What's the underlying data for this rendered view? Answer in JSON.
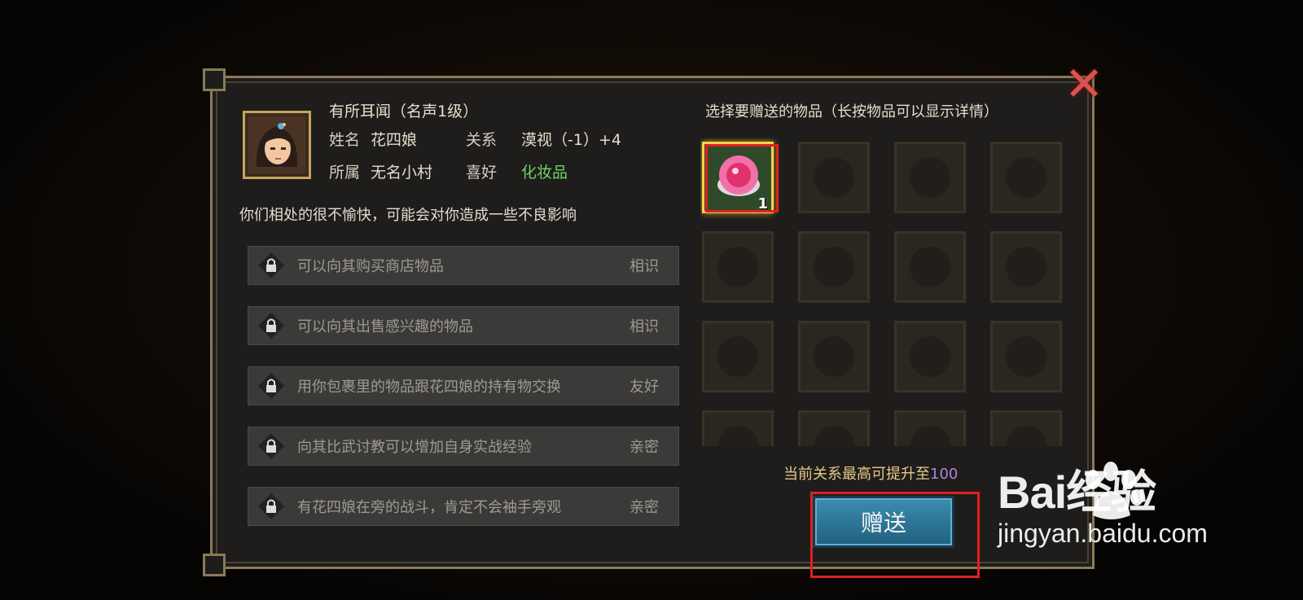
{
  "header": {
    "reputation": "有所耳闻（名声1级）",
    "name_label": "姓名",
    "name_value": "花四娘",
    "relation_label": "关系",
    "relation_value": "漠视（-1）+4",
    "affiliation_label": "所属",
    "affiliation_value": "无名小村",
    "preference_label": "喜好",
    "preference_value": "化妆品"
  },
  "description": "你们相处的很不愉快，可能会对你造成一些不良影响",
  "perks": [
    {
      "text": "可以向其购买商店物品",
      "req": "相识"
    },
    {
      "text": "可以向其出售感兴趣的物品",
      "req": "相识"
    },
    {
      "text": "用你包裹里的物品跟花四娘的持有物交换",
      "req": "友好"
    },
    {
      "text": "向其比武讨教可以增加自身实战经验",
      "req": "亲密"
    },
    {
      "text": "有花四娘在旁的战斗，肯定不会袖手旁观",
      "req": "亲密"
    }
  ],
  "inventory": {
    "instruction": "选择要赠送的物品（长按物品可以显示详情）",
    "item_qty": "1"
  },
  "limit": {
    "prefix": "当前关系最高可提升至",
    "value": "100"
  },
  "gift_button": "赠送",
  "watermark": {
    "main": "Bai经验",
    "sub": "jingyan.baidu.com"
  },
  "colors": {
    "accent_gold": "#c9a45a",
    "preference_green": "#6fd36b",
    "limit_purple": "#b083e6",
    "button_blue": "#3b8db0",
    "highlight_red": "#e02020"
  }
}
